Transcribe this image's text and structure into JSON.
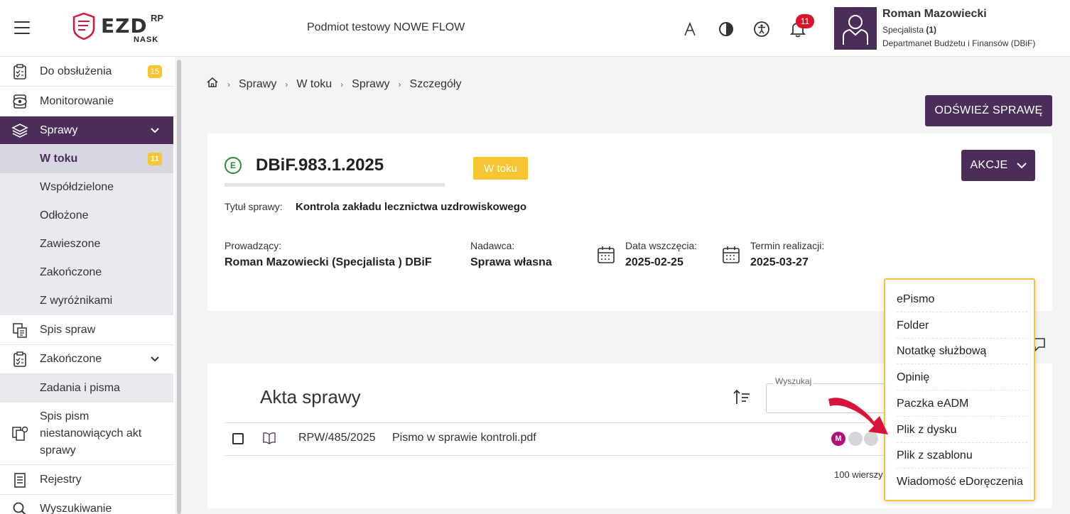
{
  "header": {
    "logo_text": "EZD",
    "logo_rp": "RP",
    "logo_nask": "NASK",
    "entity": "Podmiot testowy NOWE FLOW",
    "notifications_count": "11",
    "user": {
      "name": "Roman Mazowiecki",
      "role": "Specjalista",
      "role_count": "(1)",
      "department": "Departmanet Budżetu i Finansów (DBiF)"
    }
  },
  "sidebar": {
    "items": [
      {
        "label": "Do obsłużenia",
        "badge": "15"
      },
      {
        "label": "Monitorowanie"
      },
      {
        "label": "Sprawy"
      },
      {
        "label": "Spis spraw"
      },
      {
        "label": "Zakończone"
      },
      {
        "label": "Spis pism niestanowiących akt sprawy"
      },
      {
        "label": "Rejestry"
      },
      {
        "label": "Wyszukiwanie"
      }
    ],
    "sprawy_sub": [
      {
        "label": "W toku",
        "badge": "11"
      },
      {
        "label": "Współdzielone"
      },
      {
        "label": "Odłożone"
      },
      {
        "label": "Zawieszone"
      },
      {
        "label": "Zakończone"
      },
      {
        "label": "Z wyróżnikami"
      }
    ],
    "zakonczone_sub": [
      {
        "label": "Zadania i pisma"
      }
    ]
  },
  "breadcrumb": [
    "Sprawy",
    "W toku",
    "Sprawy",
    "Szczegóły"
  ],
  "refresh_button": "ODŚWIEŻ SPRAWĘ",
  "case": {
    "type_letter": "E",
    "number": "DBiF.983.1.2025",
    "status": "W toku",
    "actions_button": "AKCJE",
    "title_label": "Tytuł sprawy:",
    "title_value": "Kontrola zakładu lecznictwa uzdrowiskowego",
    "owner_label": "Prowadzący:",
    "owner_value": "Roman Mazowiecki (Specjalista ) DBiF",
    "sender_label": "Nadawca:",
    "sender_value": "Sprawa własna",
    "start_label": "Data wszczęcia:",
    "start_value": "2025-02-25",
    "due_label": "Termin realizacji:",
    "due_value": "2025-03-27"
  },
  "files": {
    "title": "Akta sprawy",
    "search_label": "Wyszukaj",
    "rows": [
      {
        "id": "RPW/485/2025",
        "name": "Pismo w sprawie kontroli.pdf"
      }
    ],
    "dot_m": "M",
    "rows_per_page": "100 wierszy"
  },
  "dropdown": {
    "items": [
      "ePismo",
      "Folder",
      "Notatkę służbową",
      "Opinię",
      "Paczka eADM",
      "Plik z dysku",
      "Plik z szablonu",
      "Wiadomość eDoręczenia"
    ]
  },
  "colors": {
    "primary": "#4b2d5a",
    "accent_yellow": "#f7c533",
    "notification_red": "#d8142a",
    "arrow": "#d8143a",
    "case_type_green": "#2b8a3e"
  },
  "icons": {
    "menu": "hamburger-icon",
    "font_size": "font-size-icon",
    "contrast": "contrast-icon",
    "accessibility": "accessibility-icon",
    "bell": "bell-icon"
  }
}
